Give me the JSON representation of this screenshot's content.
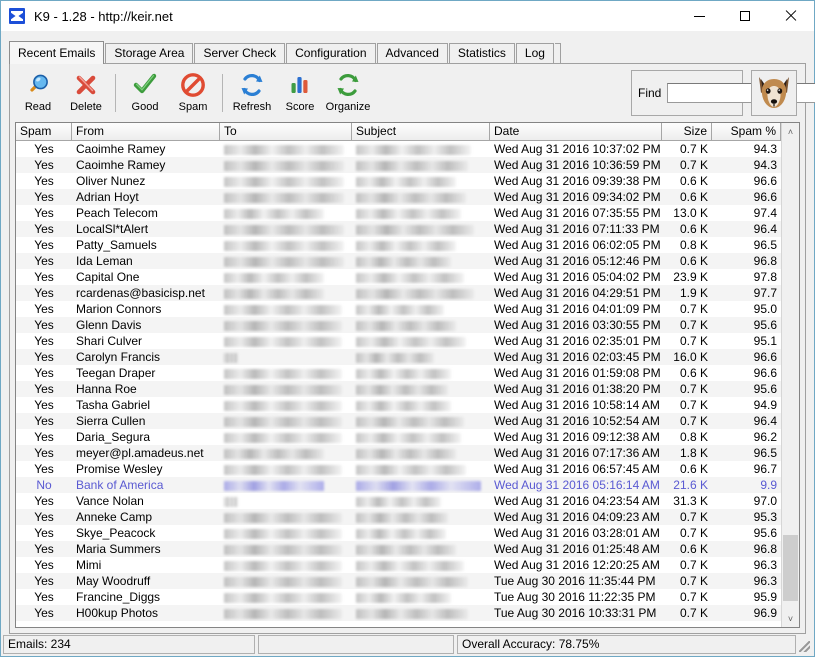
{
  "window": {
    "title": "K9 - 1.28 - http://keir.net",
    "app_icon": "k9-app-icon",
    "minimize_label": "Minimize",
    "maximize_label": "Maximize",
    "close_label": "Close"
  },
  "tabs": [
    {
      "label": "Recent Emails",
      "active": true
    },
    {
      "label": "Storage Area",
      "active": false
    },
    {
      "label": "Server Check",
      "active": false
    },
    {
      "label": "Configuration",
      "active": false
    },
    {
      "label": "Advanced",
      "active": false
    },
    {
      "label": "Statistics",
      "active": false
    },
    {
      "label": "Log",
      "active": false
    }
  ],
  "toolbar": {
    "buttons": [
      {
        "label": "Read",
        "icon": "magnifier-icon"
      },
      {
        "label": "Delete",
        "icon": "red-x-icon"
      },
      {
        "label": "Good",
        "icon": "green-check-icon"
      },
      {
        "label": "Spam",
        "icon": "no-entry-icon"
      },
      {
        "label": "Refresh",
        "icon": "blue-refresh-icon"
      },
      {
        "label": "Score",
        "icon": "bar-chart-icon"
      },
      {
        "label": "Organize",
        "icon": "green-refresh-icon"
      }
    ],
    "find_label": "Find",
    "find_value": "",
    "find_placeholder": "",
    "mascot_icon": "fox-head-icon"
  },
  "grid": {
    "columns": [
      {
        "key": "spam",
        "label": "Spam",
        "align": "center"
      },
      {
        "key": "from",
        "label": "From",
        "align": "left"
      },
      {
        "key": "to",
        "label": "To",
        "align": "left"
      },
      {
        "key": "subject",
        "label": "Subject",
        "align": "left"
      },
      {
        "key": "date",
        "label": "Date",
        "align": "left"
      },
      {
        "key": "size",
        "label": "Size",
        "align": "right"
      },
      {
        "key": "spampct",
        "label": "Spam %",
        "align": "right"
      }
    ],
    "rows": [
      {
        "spam": "Yes",
        "from": "Caoimhe Ramey",
        "to_redacted": 120,
        "subject_redacted": 115,
        "date": "Wed Aug 31 2016  10:37:02 PM",
        "size": "0.7 K",
        "spampct": "94.3",
        "selected": false
      },
      {
        "spam": "Yes",
        "from": "Caoimhe Ramey",
        "to_redacted": 120,
        "subject_redacted": 112,
        "date": "Wed Aug 31 2016  10:36:59 PM",
        "size": "0.7 K",
        "spampct": "94.3",
        "selected": false
      },
      {
        "spam": "Yes",
        "from": "Oliver Nunez",
        "to_redacted": 120,
        "subject_redacted": 100,
        "date": "Wed Aug 31 2016  09:39:38 PM",
        "size": "0.6 K",
        "spampct": "96.6",
        "selected": false
      },
      {
        "spam": "Yes",
        "from": "Adrian Hoyt",
        "to_redacted": 120,
        "subject_redacted": 110,
        "date": "Wed Aug 31 2016  09:34:02 PM",
        "size": "0.6 K",
        "spampct": "96.6",
        "selected": false
      },
      {
        "spam": "Yes",
        "from": "Peach Telecom",
        "to_redacted": 100,
        "subject_redacted": 105,
        "date": "Wed Aug 31 2016  07:35:55 PM",
        "size": "13.0 K",
        "spampct": "97.4",
        "selected": false
      },
      {
        "spam": "Yes",
        "from": "LocalSl*tAlert",
        "to_redacted": 120,
        "subject_redacted": 118,
        "date": "Wed Aug 31 2016  07:11:33 PM",
        "size": "0.6 K",
        "spampct": "96.4",
        "selected": false
      },
      {
        "spam": "Yes",
        "from": "Patty_Samuels",
        "to_redacted": 120,
        "subject_redacted": 100,
        "date": "Wed Aug 31 2016  06:02:05 PM",
        "size": "0.8 K",
        "spampct": "96.5",
        "selected": false
      },
      {
        "spam": "Yes",
        "from": "Ida Leman",
        "to_redacted": 120,
        "subject_redacted": 95,
        "date": "Wed Aug 31 2016  05:12:46 PM",
        "size": "0.6 K",
        "spampct": "96.8",
        "selected": false
      },
      {
        "spam": "Yes",
        "from": "Capital One",
        "to_redacted": 100,
        "subject_redacted": 108,
        "date": "Wed Aug 31 2016  05:04:02 PM",
        "size": "23.9 K",
        "spampct": "97.8",
        "selected": false
      },
      {
        "spam": "Yes",
        "from": "rcardenas@basicisp.net",
        "to_redacted": 100,
        "subject_redacted": 118,
        "date": "Wed Aug 31 2016  04:29:51 PM",
        "size": "1.9 K",
        "spampct": "97.7",
        "selected": false
      },
      {
        "spam": "Yes",
        "from": "Marion Connors",
        "to_redacted": 118,
        "subject_redacted": 88,
        "date": "Wed Aug 31 2016  04:01:09 PM",
        "size": "0.7 K",
        "spampct": "95.0",
        "selected": false
      },
      {
        "spam": "Yes",
        "from": "Glenn Davis",
        "to_redacted": 118,
        "subject_redacted": 100,
        "date": "Wed Aug 31 2016  03:30:55 PM",
        "size": "0.7 K",
        "spampct": "95.6",
        "selected": false
      },
      {
        "spam": "Yes",
        "from": "Shari Culver",
        "to_redacted": 118,
        "subject_redacted": 110,
        "date": "Wed Aug 31 2016  02:35:01 PM",
        "size": "0.7 K",
        "spampct": "95.1",
        "selected": false
      },
      {
        "spam": "Yes",
        "from": "Carolyn Francis",
        "to_redacted": 14,
        "subject_redacted": 78,
        "date": "Wed Aug 31 2016  02:03:45 PM",
        "size": "16.0 K",
        "spampct": "96.6",
        "selected": false
      },
      {
        "spam": "Yes",
        "from": "Teegan Draper",
        "to_redacted": 118,
        "subject_redacted": 95,
        "date": "Wed Aug 31 2016  01:59:08 PM",
        "size": "0.6 K",
        "spampct": "96.6",
        "selected": false
      },
      {
        "spam": "Yes",
        "from": "Hanna Roe",
        "to_redacted": 118,
        "subject_redacted": 92,
        "date": "Wed Aug 31 2016  01:38:20 PM",
        "size": "0.7 K",
        "spampct": "95.6",
        "selected": false
      },
      {
        "spam": "Yes",
        "from": "Tasha Gabriel",
        "to_redacted": 118,
        "subject_redacted": 95,
        "date": "Wed Aug 31 2016  10:58:14 AM",
        "size": "0.7 K",
        "spampct": "94.9",
        "selected": false
      },
      {
        "spam": "Yes",
        "from": "Sierra Cullen",
        "to_redacted": 118,
        "subject_redacted": 108,
        "date": "Wed Aug 31 2016  10:52:54 AM",
        "size": "0.7 K",
        "spampct": "96.4",
        "selected": false
      },
      {
        "spam": "Yes",
        "from": "Daria_Segura",
        "to_redacted": 118,
        "subject_redacted": 105,
        "date": "Wed Aug 31 2016  09:12:38 AM",
        "size": "0.8 K",
        "spampct": "96.2",
        "selected": false
      },
      {
        "spam": "Yes",
        "from": "meyer@pl.amadeus.net",
        "to_redacted": 100,
        "subject_redacted": 100,
        "date": "Wed Aug 31 2016  07:17:36 AM",
        "size": "1.8 K",
        "spampct": "96.5",
        "selected": false
      },
      {
        "spam": "Yes",
        "from": "Promise Wesley",
        "to_redacted": 118,
        "subject_redacted": 110,
        "date": "Wed Aug 31 2016  06:57:45 AM",
        "size": "0.6 K",
        "spampct": "96.7",
        "selected": false
      },
      {
        "spam": "No",
        "from": "Bank of America",
        "to_redacted": 100,
        "subject_redacted": 125,
        "date": "Wed Aug 31 2016  05:16:14 AM",
        "size": "21.6 K",
        "spampct": "9.9",
        "selected": true
      },
      {
        "spam": "Yes",
        "from": "Vance Nolan",
        "to_redacted": 14,
        "subject_redacted": 85,
        "date": "Wed Aug 31 2016  04:23:54 AM",
        "size": "31.3 K",
        "spampct": "97.0",
        "selected": false
      },
      {
        "spam": "Yes",
        "from": "Anneke Camp",
        "to_redacted": 118,
        "subject_redacted": 92,
        "date": "Wed Aug 31 2016  04:09:23 AM",
        "size": "0.7 K",
        "spampct": "95.3",
        "selected": false
      },
      {
        "spam": "Yes",
        "from": "Skye_Peacock",
        "to_redacted": 118,
        "subject_redacted": 90,
        "date": "Wed Aug 31 2016  03:28:01 AM",
        "size": "0.7 K",
        "spampct": "95.6",
        "selected": false
      },
      {
        "spam": "Yes",
        "from": "Maria Summers",
        "to_redacted": 118,
        "subject_redacted": 100,
        "date": "Wed Aug 31 2016  01:25:48 AM",
        "size": "0.6 K",
        "spampct": "96.8",
        "selected": false
      },
      {
        "spam": "Yes",
        "from": "Mimi",
        "to_redacted": 118,
        "subject_redacted": 108,
        "date": "Wed Aug 31 2016  12:20:25 AM",
        "size": "0.7 K",
        "spampct": "96.3",
        "selected": false
      },
      {
        "spam": "Yes",
        "from": "May Woodruff",
        "to_redacted": 118,
        "subject_redacted": 112,
        "date": "Tue Aug 30 2016  11:35:44 PM",
        "size": "0.7 K",
        "spampct": "96.3",
        "selected": false
      },
      {
        "spam": "Yes",
        "from": "Francine_Diggs",
        "to_redacted": 118,
        "subject_redacted": 95,
        "date": "Tue Aug 30 2016  11:22:35 PM",
        "size": "0.7 K",
        "spampct": "95.9",
        "selected": false
      },
      {
        "spam": "Yes",
        "from": "H00kup Photos",
        "to_redacted": 118,
        "subject_redacted": 112,
        "date": "Tue Aug 30 2016  10:33:31 PM",
        "size": "0.7 K",
        "spampct": "96.9",
        "selected": false
      }
    ],
    "scrollbar": {
      "up_glyph": "˄",
      "down_glyph": "˅",
      "thumb_top_pct": 84,
      "thumb_height_pct": 14
    }
  },
  "statusbar": {
    "emails": "Emails: 234",
    "middle": "",
    "accuracy": "Overall Accuracy: 78.75%"
  },
  "colors": {
    "selected_row": "#5a5ad2",
    "window_border": "#6fa8c4",
    "chrome": "#f0f0f0"
  }
}
